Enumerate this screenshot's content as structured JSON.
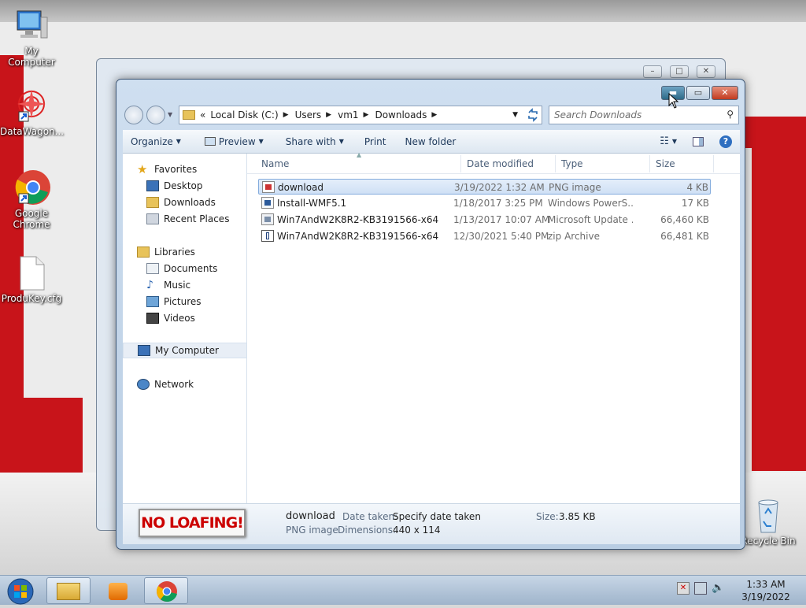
{
  "desktop": {
    "icons": [
      {
        "label": "My Computer"
      },
      {
        "label": "DataWagon..."
      },
      {
        "label": "Google Chrome"
      },
      {
        "label": "ProduKey.cfg"
      },
      {
        "label": "Recycle Bin"
      }
    ]
  },
  "explorer": {
    "address": {
      "overflow": "«",
      "segments": [
        "Local Disk (C:)",
        "Users",
        "vm1",
        "Downloads"
      ]
    },
    "search_placeholder": "Search Downloads",
    "toolbar": {
      "organize": "Organize",
      "preview": "Preview",
      "share_with": "Share with",
      "print": "Print",
      "new_folder": "New folder"
    },
    "nav": {
      "favorites": "Favorites",
      "desktop": "Desktop",
      "downloads": "Downloads",
      "recent_places": "Recent Places",
      "libraries": "Libraries",
      "documents": "Documents",
      "music": "Music",
      "pictures": "Pictures",
      "videos": "Videos",
      "my_computer": "My Computer",
      "network": "Network"
    },
    "columns": {
      "name": "Name",
      "date_modified": "Date modified",
      "type": "Type",
      "size": "Size"
    },
    "files": [
      {
        "name": "download",
        "date": "3/19/2022 1:32 AM",
        "type": "PNG image",
        "size": "4 KB"
      },
      {
        "name": "Install-WMF5.1",
        "date": "1/18/2017 3:25 PM",
        "type": "Windows PowerS...",
        "size": "17 KB"
      },
      {
        "name": "Win7AndW2K8R2-KB3191566-x64",
        "date": "1/13/2017 10:07 AM",
        "type": "Microsoft Update ...",
        "size": "66,460 KB"
      },
      {
        "name": "Win7AndW2K8R2-KB3191566-x64",
        "date": "12/30/2021 5:40 PM",
        "type": "zip Archive",
        "size": "66,481 KB"
      }
    ],
    "details": {
      "thumbnail_text": "NO LOAFING!",
      "name": "download",
      "type": "PNG image",
      "date_taken_label": "Date taken:",
      "date_taken_value": "Specify date taken",
      "dimensions_label": "Dimensions:",
      "dimensions_value": "440 x 114",
      "size_label": "Size:",
      "size_value": "3.85 KB"
    }
  },
  "taskbar": {
    "time": "1:33 AM",
    "date": "3/19/2022"
  },
  "colors": {
    "wallpaper_red": "#c8141a",
    "selection_border": "#84acdd",
    "close_button": "#c23b20"
  }
}
